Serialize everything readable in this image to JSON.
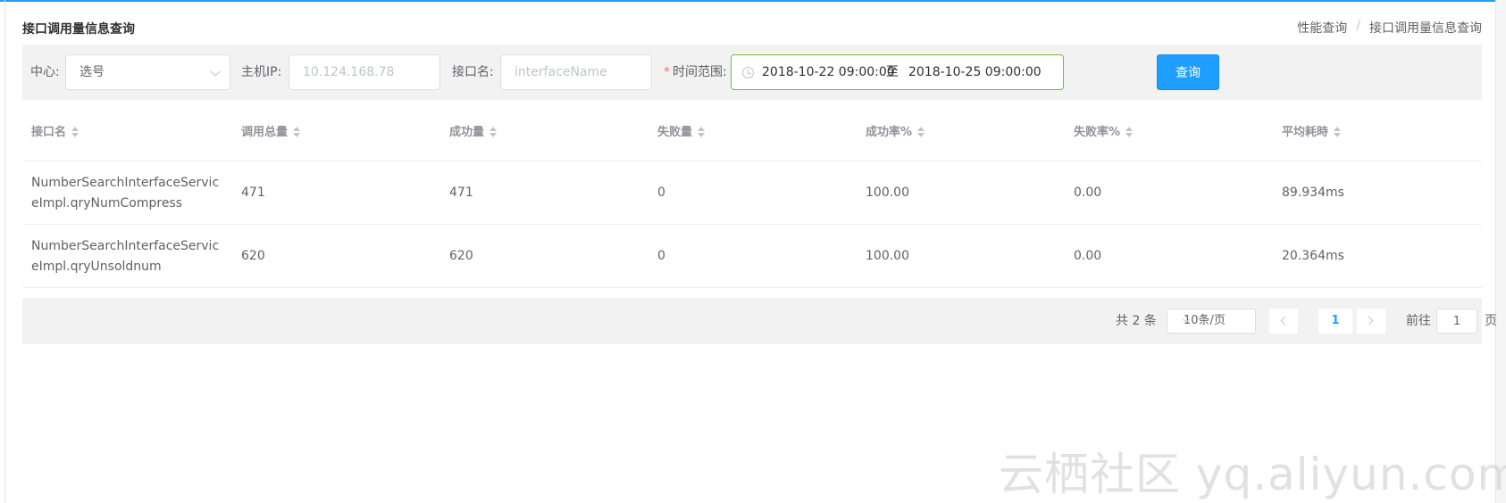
{
  "header": {
    "title": "接口调用量信息查询",
    "breadcrumb": [
      "性能查询",
      "/",
      "接口调用量信息查询"
    ]
  },
  "filters": {
    "center_label": "中心:",
    "center_value": "选号",
    "host_label": "主机IP:",
    "host_placeholder": "10.124.168.78",
    "iface_label": "接口名:",
    "iface_placeholder": "interfaceName",
    "required_mark": "*",
    "time_label": "时间范围:",
    "start": "2018-10-22 09:00:00",
    "range_sep": "至",
    "end": "2018-10-25 09:00:00",
    "query_button": "查询"
  },
  "table": {
    "columns": [
      "接口名",
      "调用总量",
      "成功量",
      "失败量",
      "成功率%",
      "失败率%",
      "平均耗時"
    ],
    "rows": [
      [
        "NumberSearchInterfaceServiceImpl.qryNumCompress",
        "471",
        "471",
        "0",
        "100.00",
        "0.00",
        "89.934ms"
      ],
      [
        "NumberSearchInterfaceServiceImpl.qryUnsoldnum",
        "620",
        "620",
        "0",
        "100.00",
        "0.00",
        "20.364ms"
      ]
    ]
  },
  "pagination": {
    "total": "共 2 条",
    "page_size": "10条/页",
    "current_page": "1",
    "goto_label": "前往",
    "goto_value": "1",
    "page_unit": "页"
  },
  "watermark": "云栖社区 yq.aliyun.com",
  "colors": {
    "primary": "#1e9fff",
    "valid_border": "#67c23a",
    "required": "#f56c6c"
  }
}
